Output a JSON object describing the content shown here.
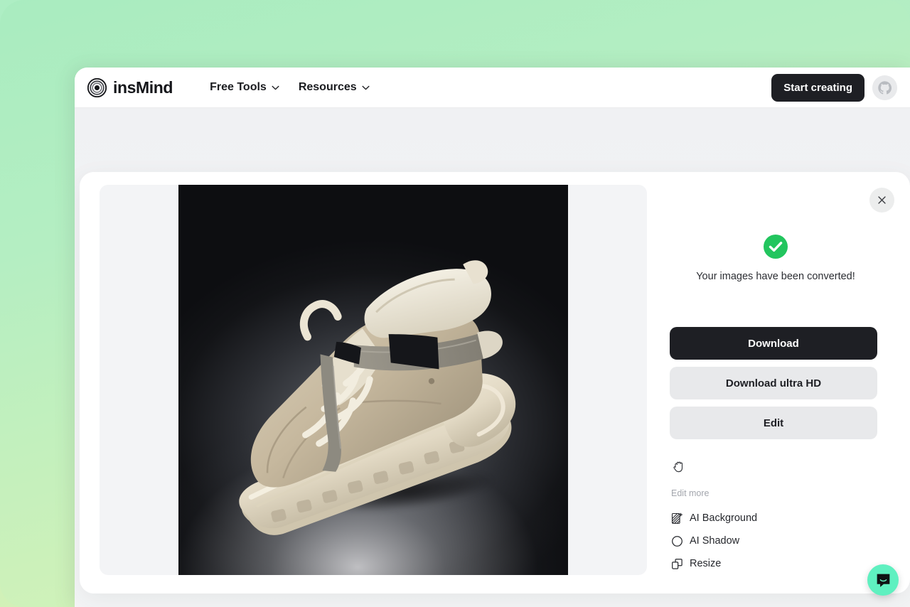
{
  "theme": {
    "bg_gradient_from": "#a9ecc0",
    "bg_gradient_to": "#ddf5b7",
    "accent_dark": "#1e1f24",
    "success_green": "#22c55e",
    "chat_green": "#5ff0c0",
    "panel_grey": "#e8e9eb"
  },
  "header": {
    "brand_name": "insMind",
    "brand_icon": "concentric-circles-logo",
    "nav": [
      {
        "label": "Free Tools",
        "icon": "chevron-down-icon"
      },
      {
        "label": "Resources",
        "icon": "chevron-down-icon"
      }
    ],
    "cta_label": "Start creating",
    "avatar_icon": "user-avatar"
  },
  "modal": {
    "close_icon": "close-icon",
    "canvas": {
      "image_alt": "beige suede high-top sneaker boot on dark studio background"
    },
    "status": {
      "icon": "success-check-icon",
      "message": "Your images have been converted!"
    },
    "actions": [
      {
        "label": "Download",
        "style": "primary"
      },
      {
        "label": "Download ultra HD",
        "style": "secondary"
      },
      {
        "label": "Edit",
        "style": "secondary"
      }
    ],
    "tool_icon": "hand-grab-icon",
    "edit_more": {
      "title": "Edit more",
      "items": [
        {
          "label": "AI Background",
          "icon": "ai-background-icon"
        },
        {
          "label": "AI Shadow",
          "icon": "ai-shadow-icon"
        },
        {
          "label": "Resize",
          "icon": "resize-icon"
        }
      ]
    }
  },
  "chat": {
    "icon": "chat-bubble-icon"
  }
}
